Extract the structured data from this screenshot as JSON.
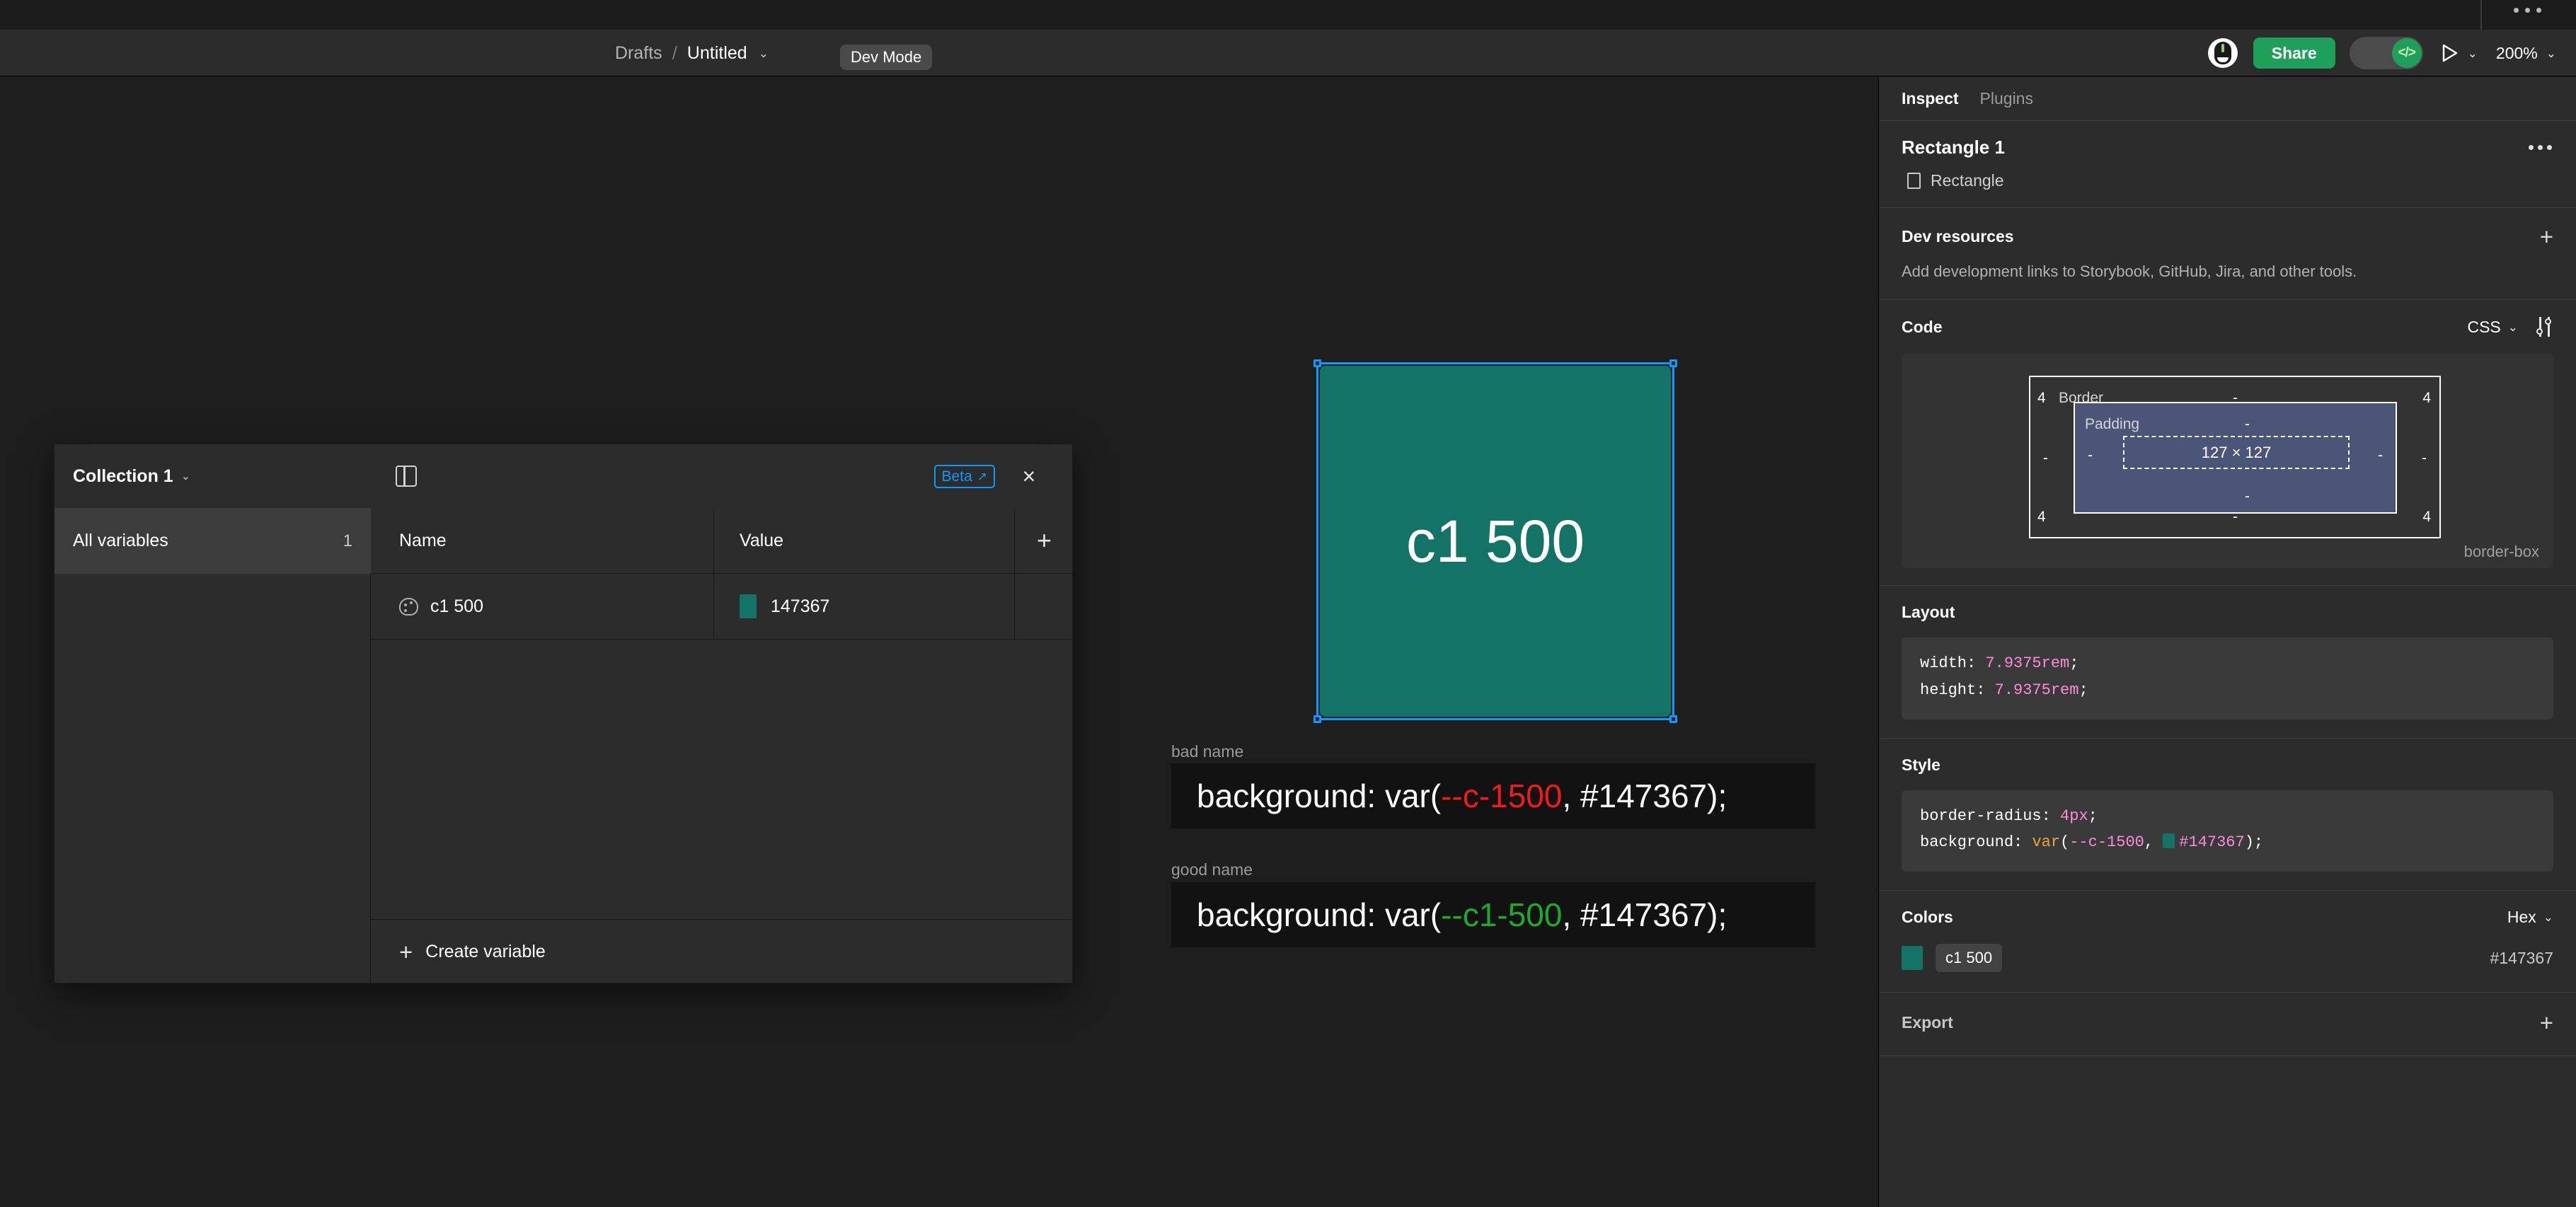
{
  "window": {
    "menu_icon": "more-horizontal-icon"
  },
  "toolbar": {
    "breadcrumb_root": "Drafts",
    "breadcrumb_separator": "/",
    "breadcrumb_file": "Untitled",
    "file_chevron": "⌄",
    "dev_mode_label": "Dev Mode",
    "share_label": "Share",
    "dev_toggle_glyph": "</>",
    "present_chevron": "⌄",
    "zoom_level": "200%",
    "zoom_chevron": "⌄"
  },
  "canvas": {
    "rect": {
      "label": "c1 500",
      "fill": "#147367",
      "selection_color": "#0d99ff"
    },
    "snippets": [
      {
        "label": "bad name",
        "prefix": "background: var(",
        "token": "--c-1500",
        "token_color": "#f11b1b",
        "suffix": ", #147367);"
      },
      {
        "label": "good name",
        "prefix": "background: var(",
        "token": "--c1-500",
        "token_color": "#1faa2a",
        "suffix": ", #147367);"
      }
    ]
  },
  "variables_modal": {
    "collection_name": "Collection 1",
    "collection_chevron": "⌄",
    "panel_toggle_icon": "sidebar-toggle-icon",
    "beta_label": "Beta",
    "beta_external_icon": "↗",
    "close_icon": "×",
    "sidebar": {
      "items": [
        {
          "label": "All variables",
          "count": "1"
        }
      ]
    },
    "table": {
      "columns": [
        "Name",
        "Value"
      ],
      "add_icon": "+",
      "rows": [
        {
          "type_icon": "palette-icon",
          "name": "c1 500",
          "swatch": "#147367",
          "value": "147367"
        }
      ]
    },
    "create_variable_label": "Create variable",
    "create_variable_icon": "+"
  },
  "inspect_panel": {
    "tabs": [
      {
        "label": "Inspect",
        "active": true
      },
      {
        "label": "Plugins",
        "active": false
      }
    ],
    "layer_name": "Rectangle 1",
    "layer_menu_icon": "more-horizontal-icon",
    "layer_type_icon": "rectangle-icon",
    "layer_type": "Rectangle",
    "dev_resources": {
      "title": "Dev resources",
      "add_icon": "+",
      "helper": "Add development links to Storybook, GitHub, Jira, and other tools."
    },
    "code": {
      "title": "Code",
      "language": "CSS",
      "language_chevron": "⌄",
      "settings_icon": "sliders-icon",
      "box_model": {
        "border_label": "Border",
        "padding_label": "Padding",
        "content_size": "127 × 127",
        "border_top_left": "4",
        "border_top_right": "4",
        "border_bottom_left": "4",
        "border_bottom_right": "4",
        "border_top": "-",
        "border_bottom": "-",
        "border_left": "-",
        "border_right": "-",
        "padding_top": "-",
        "padding_bottom": "-",
        "padding_left": "-",
        "padding_right": "-",
        "box_sizing": "border-box"
      }
    },
    "layout": {
      "title": "Layout",
      "lines": [
        {
          "prop": "width",
          "value": "7.9375rem"
        },
        {
          "prop": "height",
          "value": "7.9375rem"
        }
      ]
    },
    "style": {
      "title": "Style",
      "border_radius_prop": "border-radius",
      "border_radius_value": "4px",
      "background_prop": "background",
      "background_fn": "var",
      "background_var": "--c-1500",
      "background_swatch": "#147367",
      "background_hex": "#147367"
    },
    "colors": {
      "title": "Colors",
      "format": "Hex",
      "format_chevron": "⌄",
      "items": [
        {
          "swatch": "#147367",
          "name": "c1 500",
          "hex": "#147367"
        }
      ]
    },
    "export": {
      "title": "Export",
      "add_icon": "+"
    }
  }
}
